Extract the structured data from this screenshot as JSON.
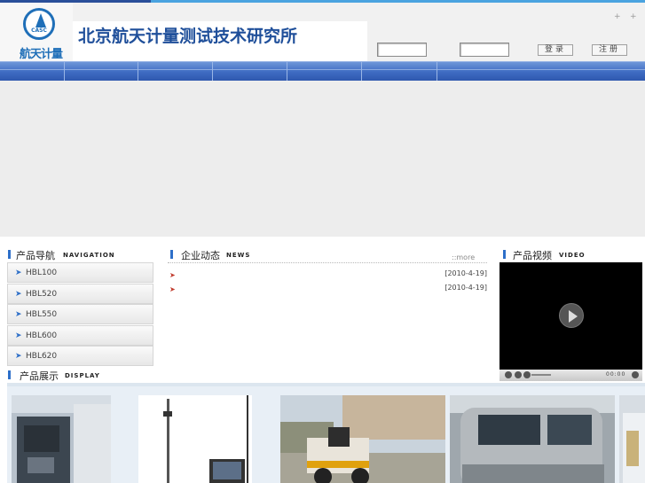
{
  "header": {
    "logo_abbr": "CASC",
    "logo_text": "航天计量",
    "title": "北京航天计量测试技术研究所",
    "plus_marks": [
      "+",
      "+"
    ]
  },
  "login": {
    "login_button": "登录",
    "register_button": "注册"
  },
  "sections": {
    "navigation": {
      "cn": "产品导航",
      "en": "NAVIGATION"
    },
    "news": {
      "cn": "企业动态",
      "en": "NEWS"
    },
    "video": {
      "cn": "产品视频",
      "en": "VIDEO"
    },
    "display": {
      "cn": "产品展示",
      "en": "DISPLAY"
    }
  },
  "nav_items": [
    "HBL100",
    "HBL520",
    "HBL550",
    "HBL600",
    "HBL620"
  ],
  "news": {
    "more_label": "::more",
    "items": [
      {
        "date": "[2010-4-19]"
      },
      {
        "date": "[2010-4-19]"
      }
    ]
  },
  "video": {
    "time_display": "00:00"
  },
  "colors": {
    "nav_bar": "#3e6bc2",
    "accent_blue": "#2d6fc9",
    "news_flag": "#c0392b"
  },
  "icons": [
    "play-icon",
    "arrow-right-icon",
    "flag-icon",
    "stop-icon",
    "volume-icon",
    "fullscreen-icon"
  ]
}
